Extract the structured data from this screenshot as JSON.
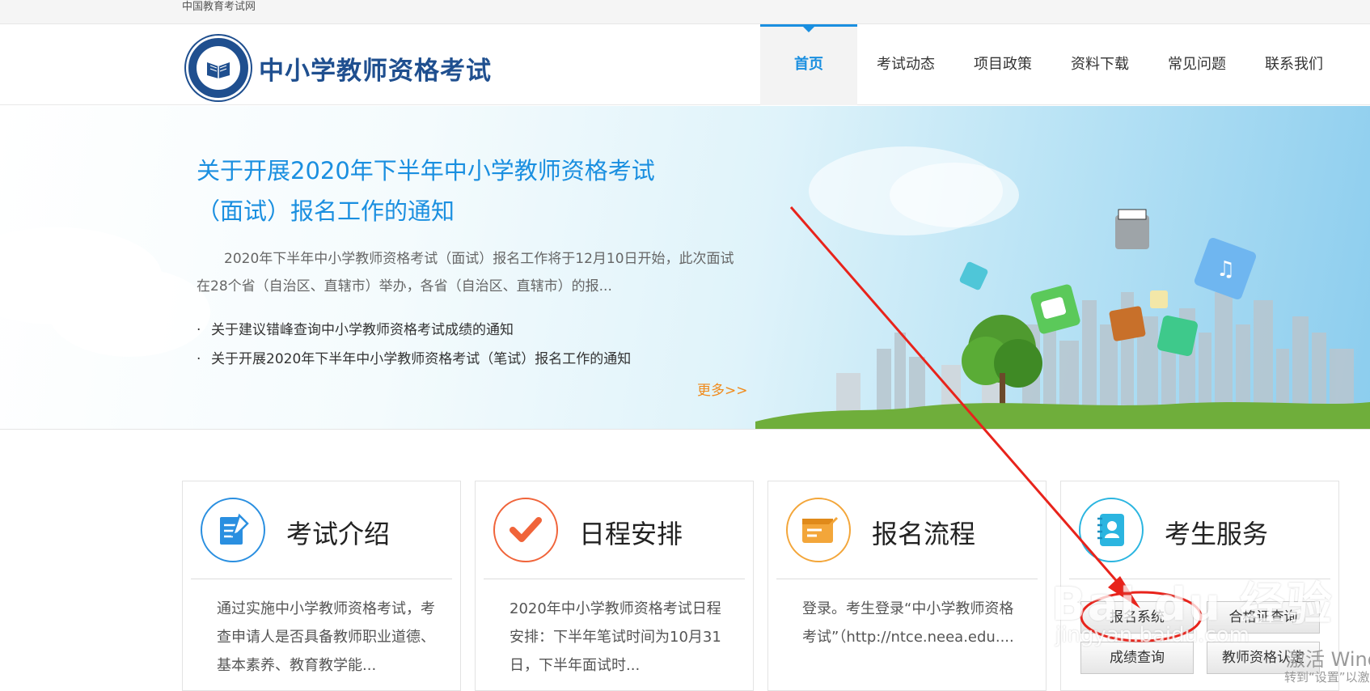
{
  "topbar": {
    "site_name": "中国教育考试网"
  },
  "header": {
    "logo_title": "中小学教师资格考试",
    "nav": [
      {
        "label": "首页",
        "active": true
      },
      {
        "label": "考试动态"
      },
      {
        "label": "项目政策"
      },
      {
        "label": "资料下载"
      },
      {
        "label": "常见问题"
      },
      {
        "label": "联系我们"
      }
    ]
  },
  "banner": {
    "title_line1": "关于开展2020年下半年中小学教师资格考试",
    "title_line2": "（面试）报名工作的通知",
    "summary": "2020年下半年中小学教师资格考试（面试）报名工作将于12月10日开始，此次面试在28个省（自治区、直辖市）举办，各省（自治区、直辖市）的报...",
    "list": [
      "关于建议错峰查询中小学教师资格考试成绩的通知",
      "关于开展2020年下半年中小学教师资格考试（笔试）报名工作的通知"
    ],
    "more": "更多>>"
  },
  "cards": [
    {
      "title": "考试介绍",
      "icon": "document-edit-icon",
      "color": "#2a8fe0",
      "text": "通过实施中小学教师资格考试，考查申请人是否具备教师职业道德、基本素养、教育教学能..."
    },
    {
      "title": "日程安排",
      "icon": "checkmark-icon",
      "color": "#f0643a",
      "text": "2020年中小学教师资格考试日程安排：下半年笔试时间为10月31日，下半年面试时..."
    },
    {
      "title": "报名流程",
      "icon": "form-edit-icon",
      "color": "#f3a63a",
      "text": "登录。考生登录“中小学教师资格考试”（http://ntce.neea.edu...."
    },
    {
      "title": "考生服务",
      "icon": "contacts-icon",
      "color": "#2bb5e0"
    }
  ],
  "services": {
    "registration": "报名系统",
    "certificate": "合格证查询",
    "scores": "成绩查询",
    "qualification": "教师资格认定"
  },
  "overlay": {
    "watermark": "Bai du 经验",
    "watermark_sub": "jingyan.baidu.com",
    "activate": "激活 Windows",
    "activate_sub": "转到“设置”以激活"
  }
}
